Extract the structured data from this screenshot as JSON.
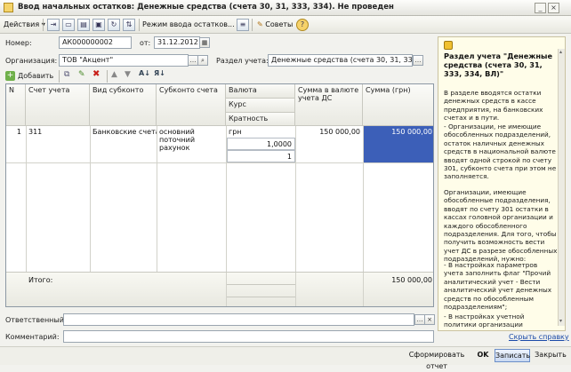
{
  "window": {
    "title": "Ввод начальных остатков: Денежные средства (счета 30, 31, 333, 334). Не проведен"
  },
  "toolbar": {
    "actions_label": "Действия",
    "mode_label": "Режим ввода остатков...",
    "tips_label": "Советы"
  },
  "form": {
    "number_label": "Номер:",
    "number_value": "АК000000002",
    "date_label": "от:",
    "date_value": "31.12.2012 1",
    "org_label": "Организация:",
    "org_value": "ТОВ \"Акцент\"",
    "section_label": "Раздел учета:",
    "section_value": "Денежные средства (счета 30, 31, 333, 334)"
  },
  "subtoolbar": {
    "add_label": "Добавить"
  },
  "table": {
    "headers": {
      "n": "N",
      "account": "Счет учета",
      "subconto_type": "Вид субконто",
      "subconto": "Субконто счета",
      "currency": "Валюта",
      "rate": "Курс",
      "multiplicity": "Кратность",
      "amount_cur": "Сумма в валюте учета ДС",
      "amount_uah": "Сумма (грн)"
    },
    "row": {
      "n": "1",
      "account": "311",
      "subconto_type": "Банковские счета",
      "subconto": "основний поточний рахунок",
      "currency": "грн",
      "rate": "1,0000",
      "multiplicity": "1",
      "amount_cur": "150 000,00",
      "amount_uah": "150 000,00"
    },
    "footer": {
      "label": "Итого:",
      "total": "150 000,00"
    }
  },
  "bottom_fields": {
    "responsible_label": "Ответственный:",
    "comment_label": "Комментарий:",
    "hide_help_link": "Скрыть справку"
  },
  "help": {
    "title": "Раздел учета \"Денежные средства (счета 30, 31, 333, 334, ВЛ)\"",
    "p1": "В разделе вводятся остатки денежных средств в кассе предприятия, на банковских счетах и в пути.",
    "p2": "- Организации, не имеющие обособленных подразделений, остаток наличных денежных средств в национальной валюте вводят одной строкой по счету 301, субконто счета при этом не заполняется.",
    "p3": "Организации, имеющие обособленные подразделения, вводят по счету 301 остатки в кассах головной организации и каждого обособленного подразделения. Для того, чтобы получить возможность вести учет ДС в разрезе обособленных подразделений, нужно:",
    "p4": "- В настройках параметров учета заполнить флаг \"Прочий аналитический учет - Вести аналитический учет денежных средств по обособленным подразделениям\";",
    "p5": "- В настройках учетной политики организации заполнить флаг"
  },
  "buttons": {
    "report_label": "Сформировать отчет",
    "ok_label": "OK",
    "save_label": "Записать",
    "close_label": "Закрыть"
  },
  "colors": {
    "selection": "#3c5fb8",
    "help_bg": "#fffde9"
  }
}
